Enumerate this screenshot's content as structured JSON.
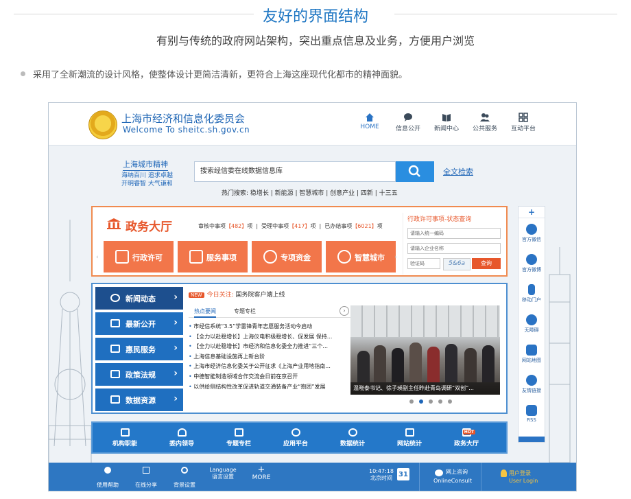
{
  "header": {
    "title": "友好的界面结构",
    "subtitle": "有别与传统的政府网站架构，突出重点信息及业务，方便用户浏览",
    "bullet": "采用了全新潮流的设计风格，使整体设计更简洁清新，更符合上海这座现代化都市的精神面貌。"
  },
  "site": {
    "logo_cn": "上海市经济和信息化委员会",
    "logo_en": "Welcome To sheitc.sh.gov.cn",
    "nav": [
      {
        "label": "HOME",
        "icon": "home-icon"
      },
      {
        "label": "信息公开",
        "icon": "chat-icon"
      },
      {
        "label": "新闻中心",
        "icon": "book-icon"
      },
      {
        "label": "公共服务",
        "icon": "users-icon"
      },
      {
        "label": "互动平台",
        "icon": "grid-icon"
      }
    ],
    "hero": {
      "city_title": "上海城市精神",
      "city_tag1": "海纳百川 追求卓越",
      "city_tag2": "开明睿智 大气谦和",
      "search_placeholder": "搜索经信委在线数据信息库",
      "fulltext": "全文检索",
      "hot": "热门搜索: 稳增长 | 新能源 | 智慧城市 | 创意产业 | 四新 | 十三五"
    },
    "gov": {
      "title": "政务大厅",
      "stats": {
        "a_label": "审核中事项",
        "a": "【482】",
        "a_unit": "项",
        "b_label": "受理中事项",
        "b": "【417】",
        "b_unit": "项",
        "c_label": "已办结事项",
        "c": "【6021】",
        "c_unit": "项"
      },
      "tiles": [
        "行政许可",
        "服务事项",
        "专项资金",
        "智慧城市"
      ],
      "query": {
        "title": "行政许可事项-状态查询",
        "p1": "请输入统一编码",
        "p2": "请输入企业名称",
        "p3": "验证码",
        "captcha": "5&6a",
        "btn": "查询"
      }
    },
    "news": {
      "menu": [
        "新闻动态",
        "最新公开",
        "惠民服务",
        "政策法规",
        "数据资源"
      ],
      "today_badge": "NEW",
      "today_label": "今日关注:",
      "today_text": "国务院客户端上线",
      "tabs": [
        "热点要闻",
        "专题专栏"
      ],
      "list": [
        "市经信系统“3.5”学雷锋青年志愿服务活动今启动",
        "【全力以赴稳增长】上海仪电积极稳增长、促发展 保持...",
        "【全力以赴稳增长】市经济和信息化委全力推进“三个...",
        "上海信息基础设施再上新台阶",
        "上海市经济信息化委关于公开征求《上海产业用地指南...",
        "中德智能制造领域合作交流会日前在京召开",
        "以供给侧结构性改革促进轨道交通装备产业“抱团”发展"
      ],
      "photo_caption": "温晓泰书记、徐子瑛副主任昨赴青岛调研“双创”..."
    },
    "shortcuts": [
      "机构职能",
      "委内领导",
      "专题专栏",
      "应用平台",
      "数据统计",
      "网站统计",
      "政务大厅"
    ],
    "hot_badge": "HOT",
    "rail": {
      "plus": "+",
      "items": [
        "官方微信",
        "官方微博",
        "移动门户",
        "无障碍",
        "网站地图",
        "友情链接",
        "RSS"
      ]
    },
    "footer": {
      "items": [
        {
          "label": "使用帮助",
          "icon": "info-icon"
        },
        {
          "label": "在线分享",
          "icon": "share-icon"
        },
        {
          "label": "背景设置",
          "icon": "gear-icon"
        },
        {
          "label": "语言设置",
          "top": "Language",
          "icon": "language-icon"
        },
        {
          "label": "MORE",
          "top": "+",
          "icon": "plus-icon"
        }
      ],
      "time": "10:47:18",
      "time_label": "北京时间",
      "date": "31",
      "online_cn": "网上咨询",
      "online_en": "OnlineConsult",
      "user_cn": "用户登录",
      "user_en": "User Login"
    }
  },
  "colors": {
    "title_blue": "#1e76c3",
    "orange": "#f2764a",
    "nav_blue": "#2478c9",
    "footer_blue": "#2e77c2"
  }
}
